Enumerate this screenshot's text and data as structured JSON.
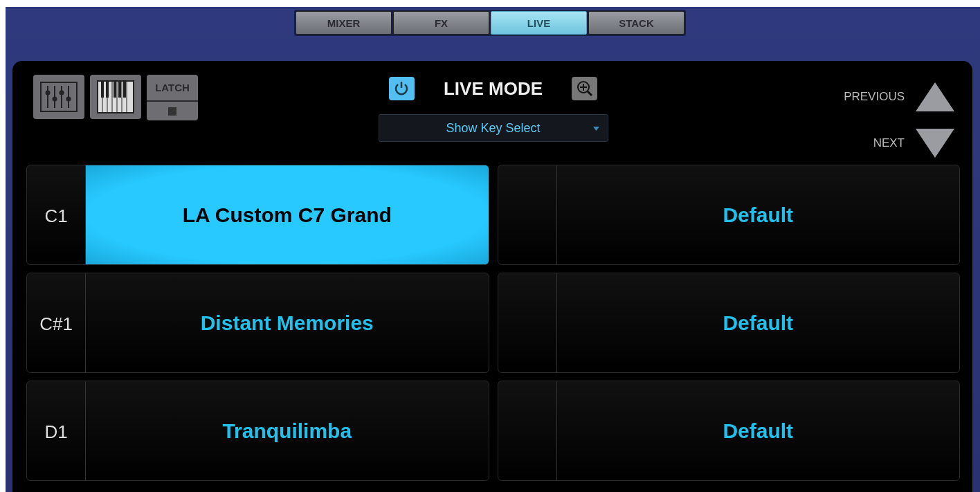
{
  "tabs": [
    {
      "label": "MIXER",
      "selected": false
    },
    {
      "label": "FX",
      "selected": false
    },
    {
      "label": "LIVE",
      "selected": true
    },
    {
      "label": "STACK",
      "selected": false
    }
  ],
  "toolbar": {
    "latch_label": "LATCH"
  },
  "live_mode": {
    "title": "LIVE MODE",
    "power_on": true,
    "dropdown": {
      "value": "Show Key Select"
    }
  },
  "navigation": {
    "previous_label": "PREVIOUS",
    "next_label": "NEXT"
  },
  "slots": [
    {
      "key": "C1",
      "left": {
        "name": "LA Custom C7 Grand",
        "selected": true
      },
      "right": {
        "name": "Default",
        "selected": false
      }
    },
    {
      "key": "C#1",
      "left": {
        "name": "Distant Memories",
        "selected": false
      },
      "right": {
        "name": "Default",
        "selected": false
      }
    },
    {
      "key": "D1",
      "left": {
        "name": "Tranquilimba",
        "selected": false
      },
      "right": {
        "name": "Default",
        "selected": false
      }
    }
  ]
}
